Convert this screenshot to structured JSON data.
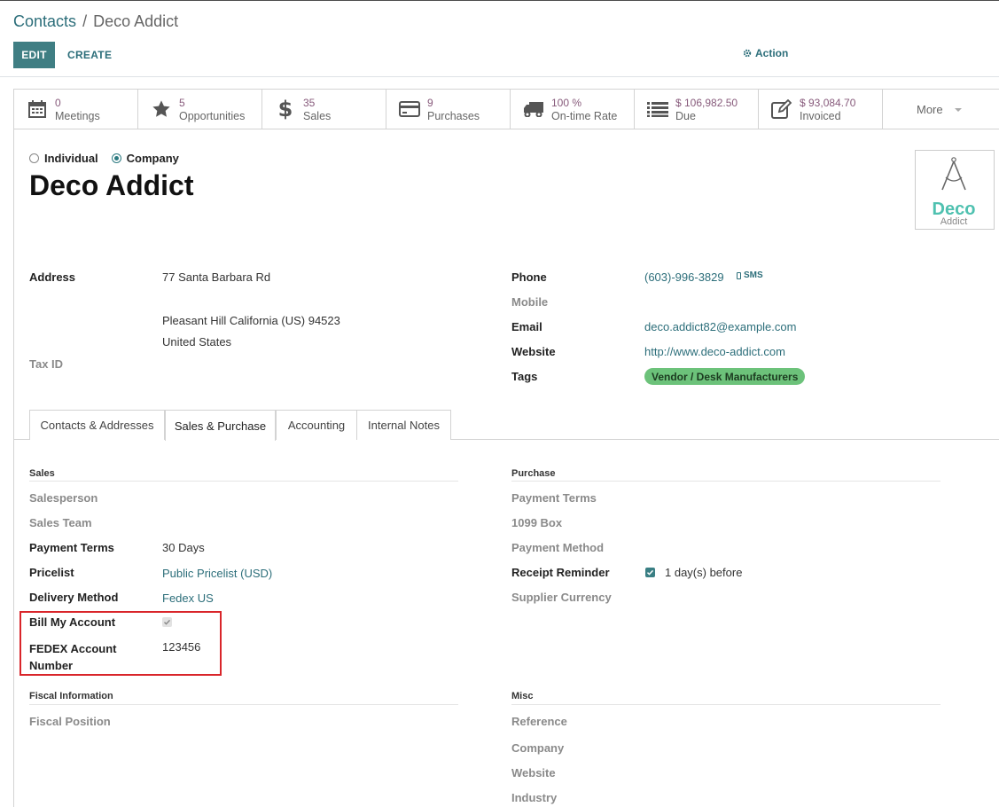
{
  "breadcrumb": {
    "parent": "Contacts",
    "separator": "/",
    "current": "Deco Addict"
  },
  "toolbar": {
    "edit_label": "EDIT",
    "create_label": "CREATE",
    "action_label": "Action"
  },
  "smart_buttons": [
    {
      "value": "0",
      "label": "Meetings",
      "icon": "calendar-icon"
    },
    {
      "value": "5",
      "label": "Opportunities",
      "icon": "star-icon"
    },
    {
      "value": "35",
      "label": "Sales",
      "icon": "dollar-icon"
    },
    {
      "value": "9",
      "label": "Purchases",
      "icon": "credit-card-icon"
    },
    {
      "value": "100 %",
      "label": "On-time Rate",
      "icon": "truck-icon"
    },
    {
      "value": "$ 106,982.50",
      "label": "Due",
      "icon": "list-icon"
    },
    {
      "value": "$ 93,084.70",
      "label": "Invoiced",
      "icon": "edit-icon"
    }
  ],
  "more_label": "More",
  "company_type": {
    "individual": "Individual",
    "company": "Company",
    "selected": "Company"
  },
  "partner_name": "Deco Addict",
  "logo": {
    "line1": "Deco",
    "line2": "Addict"
  },
  "address": {
    "label": "Address",
    "street": "77 Santa Barbara Rd",
    "city_line": "Pleasant Hill  California (US)  94523",
    "country": "United States"
  },
  "tax_id_label": "Tax ID",
  "contact": {
    "phone_label": "Phone",
    "phone": "(603)-996-3829",
    "sms_label": "SMS",
    "mobile_label": "Mobile",
    "email_label": "Email",
    "email": "deco.addict82@example.com",
    "website_label": "Website",
    "website": "http://www.deco-addict.com",
    "tags_label": "Tags",
    "tag": "Vendor / Desk Manufacturers"
  },
  "tabs": [
    "Contacts & Addresses",
    "Sales & Purchase",
    "Accounting",
    "Internal Notes"
  ],
  "active_tab": "Sales & Purchase",
  "sales": {
    "title": "Sales",
    "salesperson_label": "Salesperson",
    "sales_team_label": "Sales Team",
    "payment_terms_label": "Payment Terms",
    "payment_terms": "30 Days",
    "pricelist_label": "Pricelist",
    "pricelist": "Public Pricelist (USD)",
    "delivery_method_label": "Delivery Method",
    "delivery_method": "Fedex US",
    "bill_my_account_label": "Bill My Account",
    "bill_my_account": true,
    "fedex_account_label_1": "FEDEX Account",
    "fedex_account_label_2": "Number",
    "fedex_account": "123456"
  },
  "purchase": {
    "title": "Purchase",
    "payment_terms_label": "Payment Terms",
    "box_1099_label": "1099 Box",
    "payment_method_label": "Payment Method",
    "receipt_reminder_label": "Receipt Reminder",
    "receipt_reminder": true,
    "receipt_reminder_days": "1 day(s) before",
    "supplier_currency_label": "Supplier Currency"
  },
  "fiscal": {
    "title": "Fiscal Information",
    "fiscal_position_label": "Fiscal Position"
  },
  "misc": {
    "title": "Misc",
    "reference_label": "Reference",
    "company_label": "Company",
    "website_label": "Website",
    "industry_label": "Industry"
  },
  "colors": {
    "accent": "#3f7e83",
    "link": "#2c6e7a",
    "stat_value": "#875a7b",
    "tag": "#6cc27a",
    "highlight": "#d9252a"
  }
}
